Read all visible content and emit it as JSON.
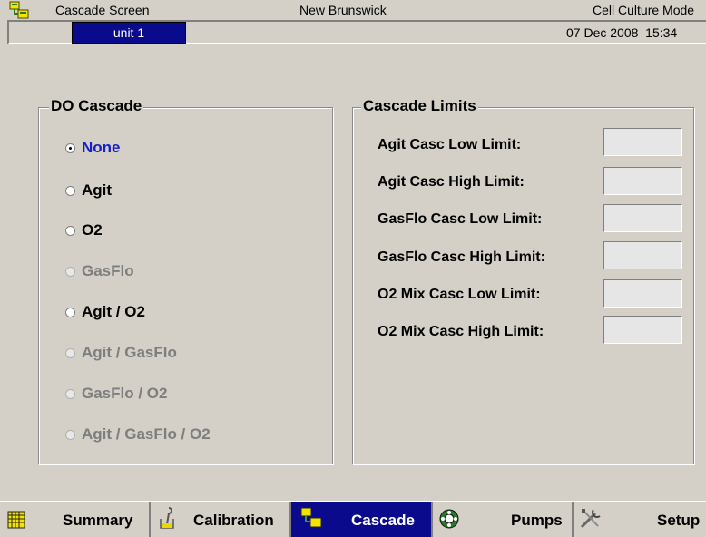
{
  "titlebar": {
    "screen": "Cascade Screen",
    "company": "New Brunswick",
    "mode": "Cell Culture Mode"
  },
  "unit": {
    "label": "unit 1"
  },
  "datetime": "07 Dec 2008  15:34",
  "do_cascade": {
    "title": "DO Cascade",
    "options": [
      {
        "label": "None",
        "state": "selected"
      },
      {
        "label": "Agit",
        "state": "enabled"
      },
      {
        "label": "O2",
        "state": "enabled"
      },
      {
        "label": "GasFlo",
        "state": "disabled"
      },
      {
        "label": "Agit / O2",
        "state": "enabled"
      },
      {
        "label": "Agit / GasFlo",
        "state": "disabled"
      },
      {
        "label": "GasFlo / O2",
        "state": "disabled"
      },
      {
        "label": "Agit / GasFlo / O2",
        "state": "disabled"
      }
    ]
  },
  "limits": {
    "title": "Cascade Limits",
    "fields": [
      {
        "label": "Agit Casc Low Limit:",
        "value": ""
      },
      {
        "label": "Agit Casc High Limit:",
        "value": ""
      },
      {
        "label": "GasFlo Casc Low Limit:",
        "value": ""
      },
      {
        "label": "GasFlo Casc High Limit:",
        "value": ""
      },
      {
        "label": "O2 Mix Casc Low Limit:",
        "value": ""
      },
      {
        "label": "O2 Mix Casc High Limit:",
        "value": ""
      }
    ]
  },
  "nav": [
    {
      "label": "Summary",
      "icon": "grid-icon"
    },
    {
      "label": "Calibration",
      "icon": "probe-icon"
    },
    {
      "label": "Cascade",
      "icon": "cascade-icon",
      "active": true
    },
    {
      "label": "Pumps",
      "icon": "pump-icon"
    },
    {
      "label": "Setup",
      "icon": "tools-icon"
    }
  ]
}
